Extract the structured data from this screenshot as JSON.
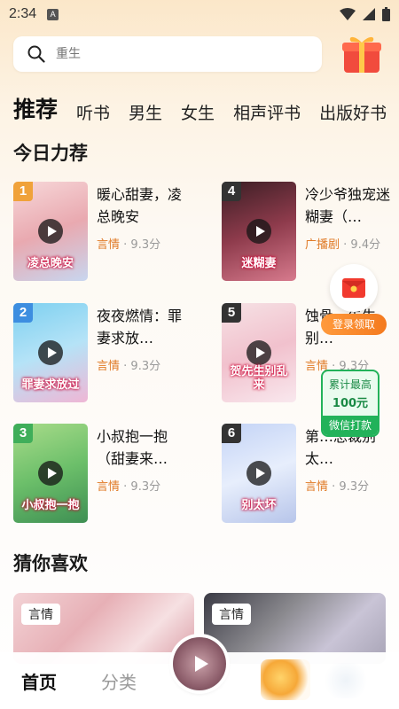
{
  "status": {
    "time": "2:34"
  },
  "search": {
    "placeholder": "重生"
  },
  "tabs": [
    "推荐",
    "听书",
    "男生",
    "女生",
    "相声评书",
    "出版好书"
  ],
  "sections": {
    "today": "今日力荐",
    "guess": "猜你喜欢"
  },
  "books": [
    {
      "rank": "1",
      "title": "暖心甜妻，凌总晚安",
      "genre": "言情",
      "score": "· 9.3分",
      "cover_text": "凌总晚安",
      "badge_color": "#f0a23a"
    },
    {
      "rank": "2",
      "title": "夜夜燃情：罪妻求放…",
      "genre": "言情",
      "score": "· 9.3分",
      "cover_text": "罪妻求放过",
      "badge_color": "#3d8ee0"
    },
    {
      "rank": "3",
      "title": "小叔抱一抱（甜妻来…",
      "genre": "言情",
      "score": "· 9.3分",
      "cover_text": "小叔抱一抱",
      "badge_color": "#3fae5a"
    },
    {
      "rank": "4",
      "title": "冷少爷独宠迷糊妻（…",
      "genre": "广播剧",
      "score": "· 9.4分",
      "cover_text": "迷糊妻",
      "badge_color": "#333333"
    },
    {
      "rank": "5",
      "title": "蚀骨…先生，别…",
      "genre": "言情",
      "score": "· 9.3分",
      "cover_text": "贺先生别乱来",
      "badge_color": "#333333"
    },
    {
      "rank": "6",
      "title": "第…总裁别太…",
      "genre": "言情",
      "score": "· 9.3分",
      "cover_text": "别太坏",
      "badge_color": "#333333"
    }
  ],
  "guess": [
    {
      "tag": "言情"
    },
    {
      "tag": "言情"
    }
  ],
  "float_login": {
    "label": "登录领取"
  },
  "float_money": {
    "line1": "累计最高",
    "line2": "100元",
    "line3": "微信打款"
  },
  "nav": {
    "home": "首页",
    "category": "分类"
  }
}
